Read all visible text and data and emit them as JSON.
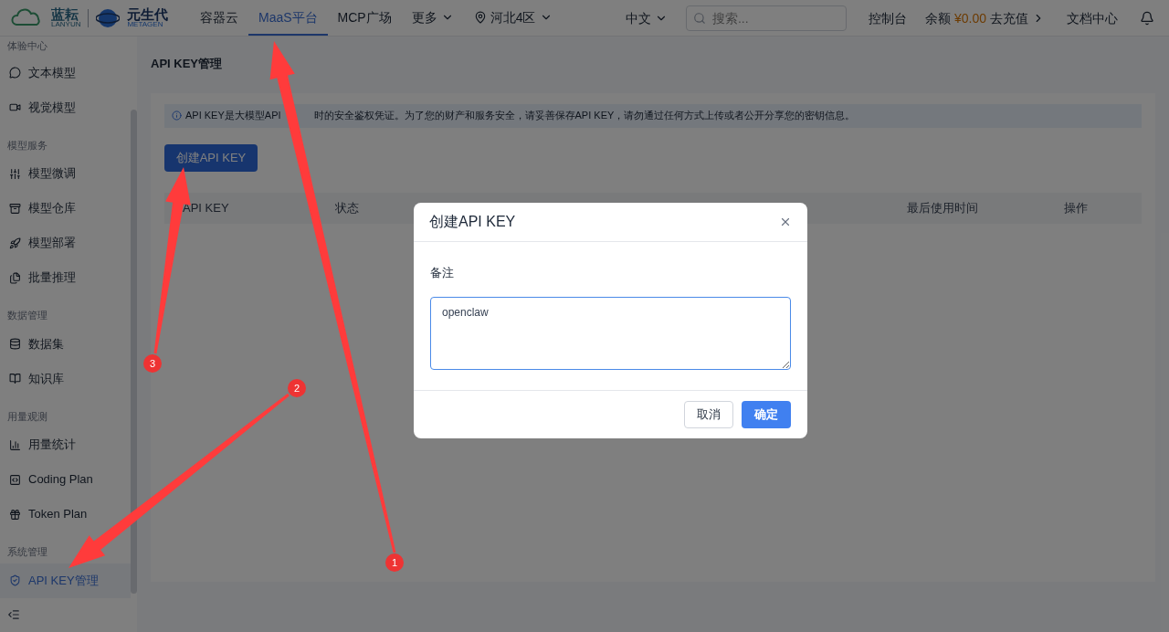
{
  "topbar": {
    "logo_primary": {
      "name": "蓝耘",
      "sub": "LANYUN"
    },
    "logo_secondary": {
      "name": "元生代",
      "sub": "METAGEN"
    },
    "nav": [
      {
        "label": "容器云",
        "selected": false,
        "kind": "link"
      },
      {
        "label": "MaaS平台",
        "selected": true,
        "kind": "link"
      },
      {
        "label": "MCP广场",
        "selected": false,
        "kind": "link"
      },
      {
        "label": "更多",
        "selected": false,
        "kind": "dropdown"
      },
      {
        "label": "河北4区",
        "selected": false,
        "kind": "region"
      }
    ],
    "language": "中文",
    "search": {
      "placeholder": "搜索..."
    },
    "console": "控制台",
    "balance": {
      "label": "余额",
      "amount": "¥0.00",
      "action": "去充值"
    },
    "docs": "文档中心"
  },
  "sidebar": {
    "sections": [
      {
        "title": "体验中心",
        "items": [
          {
            "label": "文本模型",
            "selected": false
          },
          {
            "label": "视觉模型",
            "selected": false
          }
        ]
      },
      {
        "title": "模型服务",
        "items": [
          {
            "label": "模型微调",
            "selected": false
          },
          {
            "label": "模型仓库",
            "selected": false
          },
          {
            "label": "模型部署",
            "selected": false
          },
          {
            "label": "批量推理",
            "selected": false
          }
        ]
      },
      {
        "title": "数据管理",
        "items": [
          {
            "label": "数据集",
            "selected": false
          },
          {
            "label": "知识库",
            "selected": false
          }
        ]
      },
      {
        "title": "用量观测",
        "items": [
          {
            "label": "用量统计",
            "selected": false
          },
          {
            "label": "Coding Plan",
            "selected": false
          },
          {
            "label": "Token Plan",
            "selected": false
          }
        ]
      },
      {
        "title": "系统管理",
        "items": [
          {
            "label": "API KEY管理",
            "selected": true
          }
        ]
      }
    ]
  },
  "page": {
    "title": "API KEY管理",
    "notice": [
      "API KEY是大模型API",
      "时的安全鉴权凭证。为了您的财产和服务安全，请妥善保存API KEY，请勿通过任何方式上传或者公开分享您的密钥信息。"
    ],
    "create_button": "创建API KEY",
    "table": {
      "columns": [
        "API KEY",
        "状态",
        "最后使用时间",
        "操作"
      ]
    }
  },
  "modal": {
    "title": "创建API KEY",
    "field": {
      "label": "备注",
      "value": "openclaw"
    },
    "buttons": [
      {
        "label": "取消",
        "kind": "default"
      },
      {
        "label": "确定",
        "kind": "primary"
      }
    ]
  },
  "annotations": [
    {
      "label": "1"
    },
    {
      "label": "2"
    },
    {
      "label": "3"
    }
  ]
}
